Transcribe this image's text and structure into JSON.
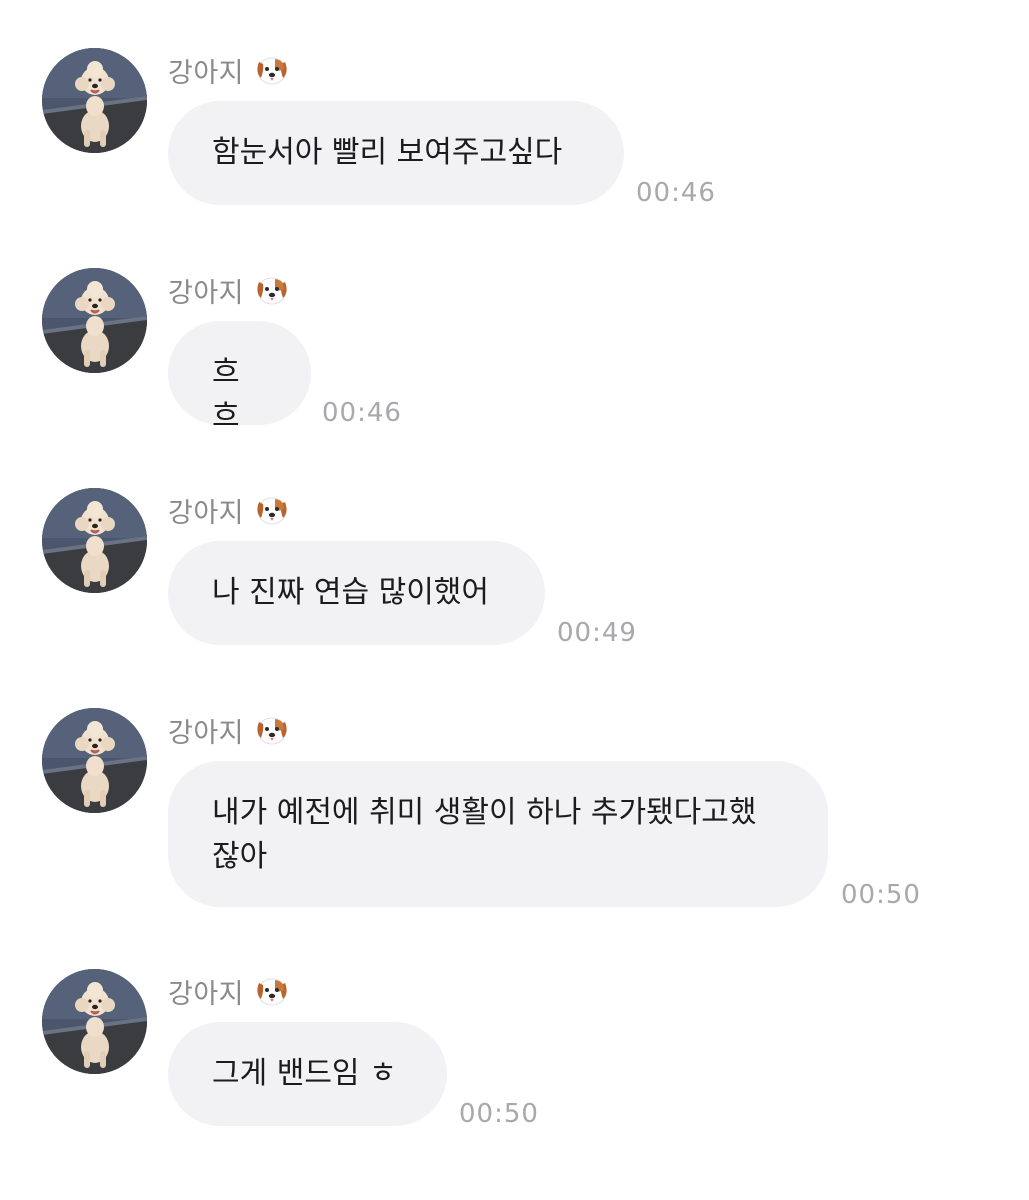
{
  "chat": {
    "messages": [
      {
        "sender": "강아지",
        "text": "함눈서아 빨리 보여주고싶다",
        "time": "00:46"
      },
      {
        "sender": "강아지",
        "text": "흐흐",
        "time": "00:46"
      },
      {
        "sender": "강아지",
        "text": "나 진짜 연습 많이했어",
        "time": "00:49"
      },
      {
        "sender": "강아지",
        "text": "내가 예전에 취미 생활이 하나 추가됐다고했\n잖아",
        "time": "00:50"
      },
      {
        "sender": "강아지",
        "text": "그게 밴드임 ㅎ",
        "time": "00:50"
      }
    ],
    "sender_emoji_icon": "dog-face-icon",
    "bubble_color": "#f2f2f5",
    "timestamp_color": "#a8a8ad",
    "sender_name_color": "#8a8a8a"
  }
}
